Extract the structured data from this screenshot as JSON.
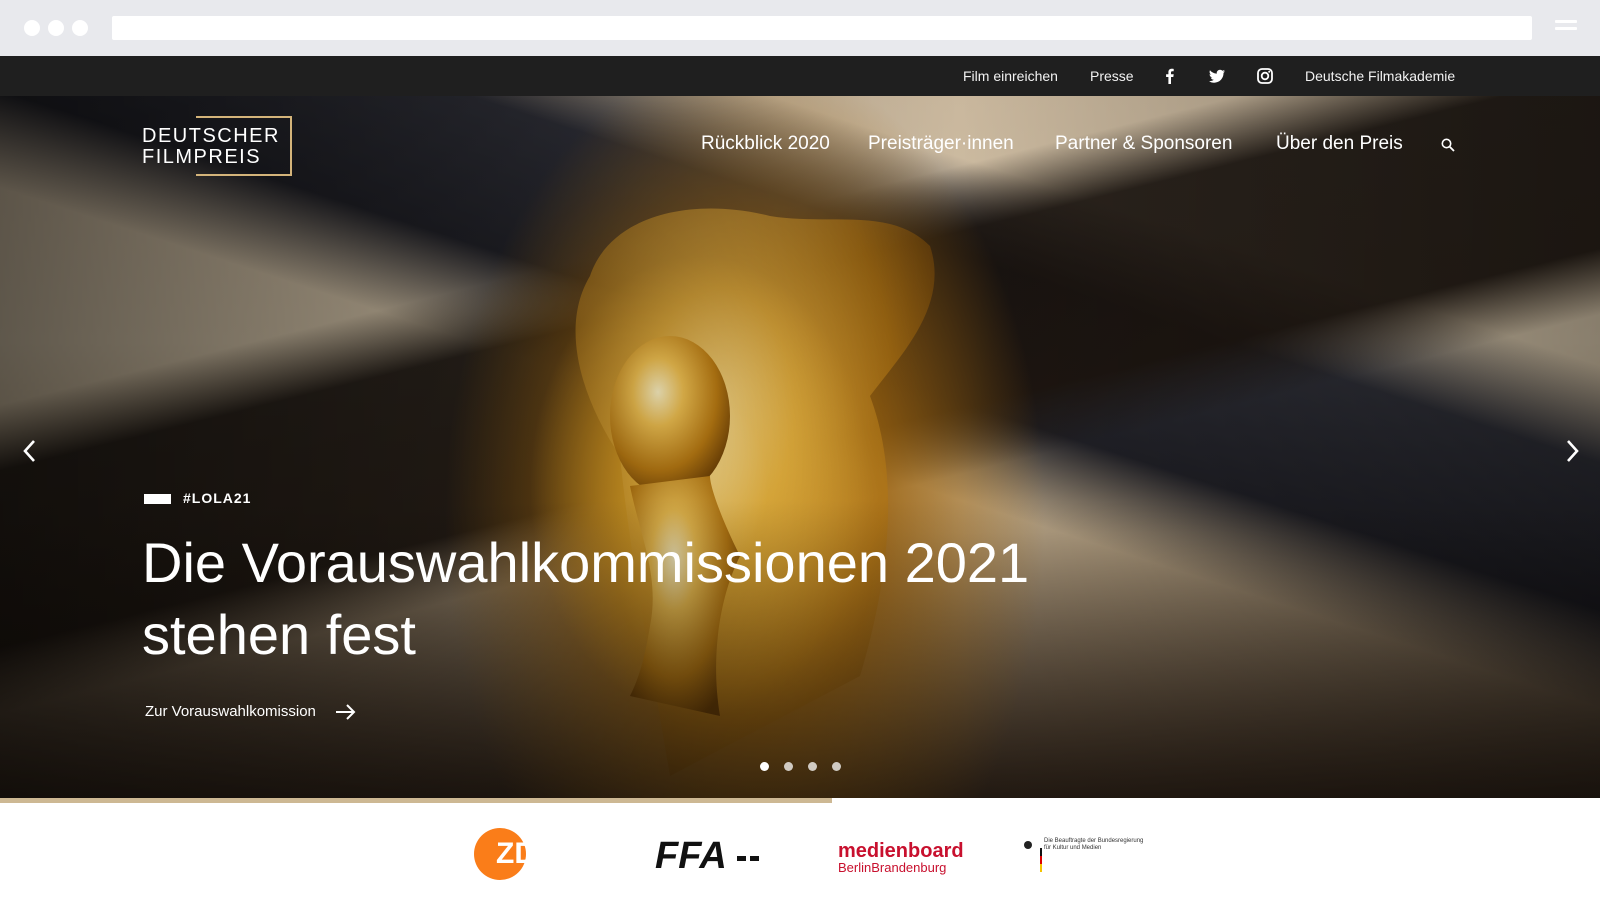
{
  "topbar": {
    "film_einreichen": "Film einreichen",
    "presse": "Presse",
    "filmakademie": "Deutsche Filmakademie",
    "social_icons": [
      "facebook-icon",
      "twitter-icon",
      "instagram-icon"
    ]
  },
  "logo": {
    "line1": "DEUTSCHER",
    "line2": "FILMPREIS"
  },
  "nav": {
    "items": [
      {
        "label": "Rückblick 2020"
      },
      {
        "label": "Preisträger·innen"
      },
      {
        "label": "Partner & Sponsoren"
      },
      {
        "label": "Über den Preis"
      }
    ]
  },
  "hero": {
    "tag": "#LOLA21",
    "headline_line1": "Die Vorauswahlkommissionen 2021",
    "headline_line2": "stehen fest",
    "cta": "Zur Vorauswahlkomission",
    "slides_total": 4,
    "slide_active": 1,
    "progress": 0.52
  },
  "sponsors": {
    "zdf": "ZDF",
    "ffa": "FFA",
    "medienboard_line1": "medienboard",
    "medienboard_line2": "BerlinBrandenburg",
    "bkm_text": "Die Beauftragte der Bundesregierung für Kultur und Medien"
  },
  "colors": {
    "topbar_bg": "#1f1f1f",
    "logo_frame": "#d4b47a",
    "progress": "#cdb893",
    "zdf_orange": "#fa7d19",
    "medienboard_red": "#c8102e"
  }
}
